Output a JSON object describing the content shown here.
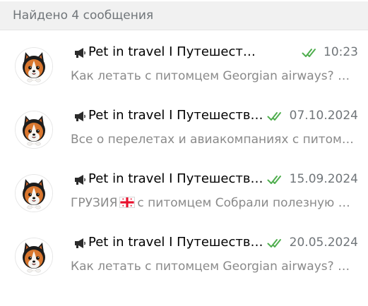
{
  "header": {
    "results_count": "Найдено 4 сообщения"
  },
  "colors": {
    "read_check": "#4fae4e",
    "header_bg": "#f1f1f1",
    "muted_text": "#707579"
  },
  "results": [
    {
      "channel_icon": "megaphone-icon",
      "channel_name": "Pet in travel I Путешествия с питомцем",
      "status_icon": "double-check-icon",
      "date": "10:23",
      "preview": "Как летать с питомцем Georgian airways? Подробно о правилах перевозки",
      "avatar_icon": "pomeranian-dog-avatar"
    },
    {
      "channel_icon": "megaphone-icon",
      "channel_name": "Pet in travel I Путешествия с питомцем",
      "status_icon": "double-check-icon",
      "date": "07.10.2024",
      "preview": "Все о перелетах и авиакомпаниях с питомцем",
      "avatar_icon": "pomeranian-dog-avatar"
    },
    {
      "channel_icon": "megaphone-icon",
      "channel_name": "Pet in travel I Путешествия с питомцем",
      "status_icon": "double-check-icon",
      "date": "15.09.2024",
      "preview_before_flag": "ГРУЗИЯ",
      "flag_icon": "georgia-flag-icon",
      "preview_after_flag": "с питомцем  Собрали полезную информацию",
      "avatar_icon": "pomeranian-dog-avatar"
    },
    {
      "channel_icon": "megaphone-icon",
      "channel_name": "Pet in travel I Путешествия с питомцем",
      "status_icon": "double-check-icon",
      "date": "20.05.2024",
      "preview": "Как летать с питомцем Georgian airways? Подробно о правилах перевозки",
      "avatar_icon": "pomeranian-dog-avatar"
    }
  ]
}
